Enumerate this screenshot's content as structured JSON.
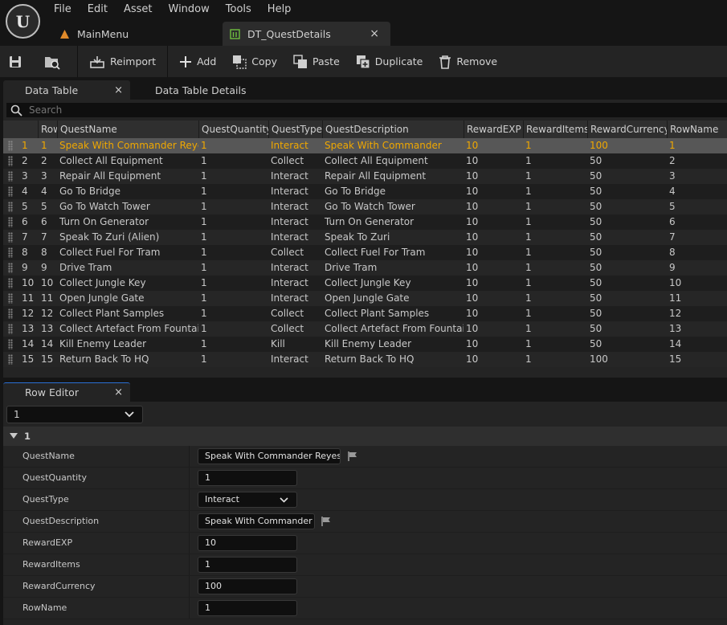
{
  "menu": [
    "File",
    "Edit",
    "Asset",
    "Window",
    "Tools",
    "Help"
  ],
  "tabs": {
    "main": "MainMenu",
    "active": "DT_QuestDetails"
  },
  "toolbar": {
    "reimport": "Reimport",
    "add": "Add",
    "copy": "Copy",
    "paste": "Paste",
    "duplicate": "Duplicate",
    "remove": "Remove"
  },
  "panels": {
    "data_table": "Data Table",
    "data_table_details": "Data Table Details",
    "row_editor": "Row Editor"
  },
  "search": {
    "placeholder": "Search"
  },
  "columns": [
    "Row",
    "QuestName",
    "QuestQuantity",
    "QuestType",
    "QuestDescription",
    "RewardEXP",
    "RewardItems",
    "RewardCurrency",
    "RowName"
  ],
  "rows": [
    [
      "1",
      "1",
      "Speak With Commander Reyes",
      "1",
      "Interact",
      "Speak With Commander",
      "10",
      "1",
      "100",
      "1"
    ],
    [
      "2",
      "2",
      "Collect All Equipment",
      "1",
      "Collect",
      "Collect All Equipment",
      "10",
      "1",
      "50",
      "2"
    ],
    [
      "3",
      "3",
      "Repair All Equipment",
      "1",
      "Interact",
      "Repair All Equipment",
      "10",
      "1",
      "50",
      "3"
    ],
    [
      "4",
      "4",
      "Go To Bridge",
      "1",
      "Interact",
      "Go To Bridge",
      "10",
      "1",
      "50",
      "4"
    ],
    [
      "5",
      "5",
      "Go To Watch Tower",
      "1",
      "Interact",
      "Go To Watch Tower",
      "10",
      "1",
      "50",
      "5"
    ],
    [
      "6",
      "6",
      "Turn On Generator",
      "1",
      "Interact",
      "Turn On Generator",
      "10",
      "1",
      "50",
      "6"
    ],
    [
      "7",
      "7",
      "Speak To Zuri (Alien)",
      "1",
      "Interact",
      "Speak To Zuri",
      "10",
      "1",
      "50",
      "7"
    ],
    [
      "8",
      "8",
      "Collect Fuel For Tram",
      "1",
      "Collect",
      "Collect Fuel For Tram",
      "10",
      "1",
      "50",
      "8"
    ],
    [
      "9",
      "9",
      "Drive Tram",
      "1",
      "Interact",
      "Drive Tram",
      "10",
      "1",
      "50",
      "9"
    ],
    [
      "10",
      "10",
      "Collect Jungle Key",
      "1",
      "Interact",
      "Collect Jungle Key",
      "10",
      "1",
      "50",
      "10"
    ],
    [
      "11",
      "11",
      "Open Jungle Gate",
      "1",
      "Interact",
      "Open Jungle Gate",
      "10",
      "1",
      "50",
      "11"
    ],
    [
      "12",
      "12",
      "Collect Plant Samples",
      "1",
      "Collect",
      "Collect Plant Samples",
      "10",
      "1",
      "50",
      "12"
    ],
    [
      "13",
      "13",
      "Collect Artefact From Fountain",
      "1",
      "Collect",
      "Collect Artefact From Fountain",
      "10",
      "1",
      "50",
      "13"
    ],
    [
      "14",
      "14",
      "Kill Enemy Leader",
      "1",
      "Kill",
      "Kill Enemy Leader",
      "10",
      "1",
      "50",
      "14"
    ],
    [
      "15",
      "15",
      "Return Back To HQ",
      "1",
      "Interact",
      "Return Back To HQ",
      "10",
      "1",
      "100",
      "15"
    ]
  ],
  "row_editor": {
    "selected_row": "1",
    "category": "1",
    "props": [
      {
        "name": "QuestName",
        "value": "Speak With Commander Reyes"
      },
      {
        "name": "QuestQuantity",
        "value": "1"
      },
      {
        "name": "QuestType",
        "value": "Interact"
      },
      {
        "name": "QuestDescription",
        "value": "Speak With Commander"
      },
      {
        "name": "RewardEXP",
        "value": "10"
      },
      {
        "name": "RewardItems",
        "value": "1"
      },
      {
        "name": "RewardCurrency",
        "value": "100"
      },
      {
        "name": "RowName",
        "value": "1"
      }
    ]
  },
  "colors": {
    "selected_text": "#f0a800",
    "accent": "#2b6fd4"
  }
}
